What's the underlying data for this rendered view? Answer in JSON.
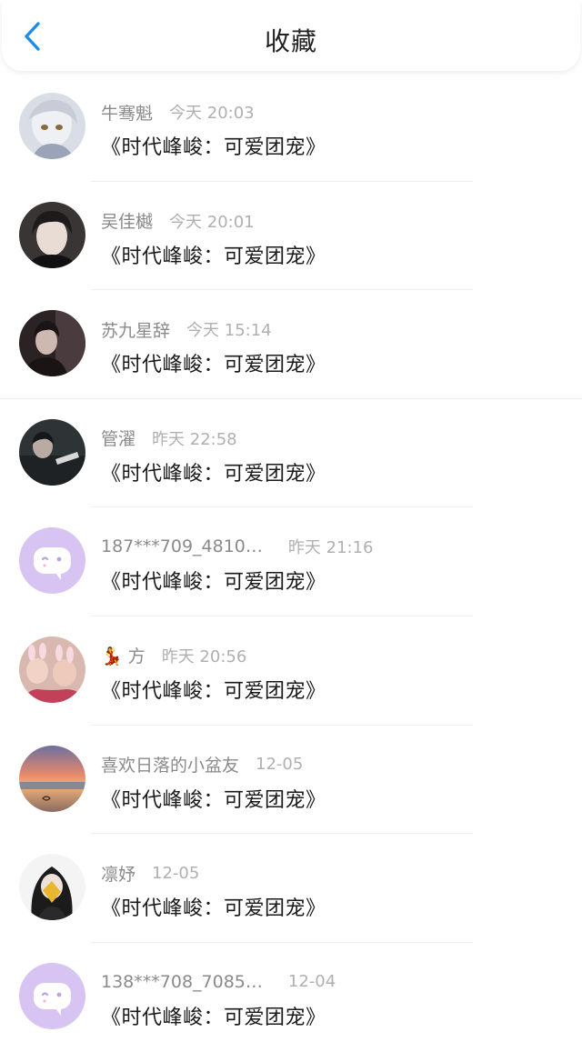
{
  "header": {
    "title": "收藏",
    "back_icon": "chevron-left-icon",
    "accent_color": "#1f8de8"
  },
  "items": [
    {
      "name": "牛骞魁",
      "time": "今天 20:03",
      "title": "《时代峰峻：可爱团宠》",
      "avatar": "anime-character-avatar"
    },
    {
      "name": "吴佳樾",
      "time": "今天 20:01",
      "title": "《时代峰峻：可爱团宠》",
      "avatar": "portrait-photo-avatar"
    },
    {
      "name": "苏九星辞",
      "time": "今天 15:14",
      "title": "《时代峰峻：可爱团宠》",
      "avatar": "dark-photo-avatar"
    },
    {
      "name": "管濯",
      "time": "昨天 22:58",
      "title": "《时代峰峻：可爱团宠》",
      "avatar": "dark-photo-avatar"
    },
    {
      "name": "187***709_4810…",
      "time": "昨天 21:16",
      "title": "《时代峰峻：可爱团宠》",
      "avatar": "default-chat-bubble-avatar"
    },
    {
      "name": "💃 方",
      "time": "昨天 20:56",
      "title": "《时代峰峻：可爱团宠》",
      "avatar": "group-photo-avatar"
    },
    {
      "name": "喜欢日落的小盆友",
      "time": "12-05",
      "title": "《时代峰峻：可爱团宠》",
      "avatar": "sunset-beach-avatar"
    },
    {
      "name": "凛妤",
      "time": "12-05",
      "title": "《时代峰峻：可爱团宠》",
      "avatar": "girl-with-leaf-avatar"
    },
    {
      "name": "138***708_7085…",
      "time": "12-04",
      "title": "《时代峰峻：可爱团宠》",
      "avatar": "default-chat-bubble-avatar"
    }
  ]
}
